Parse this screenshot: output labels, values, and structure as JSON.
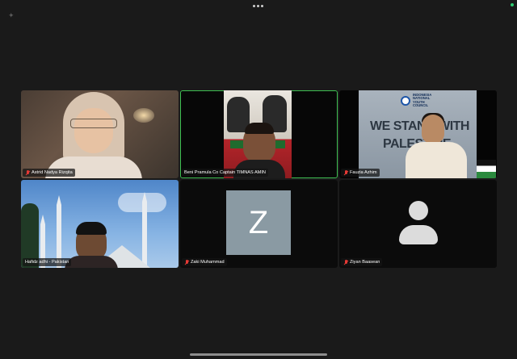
{
  "participants": [
    {
      "name": "Astrid Nadya Rizqita",
      "muted": true,
      "video": true
    },
    {
      "name": "Beni Pramula Co Captain TIMNAS AMIN",
      "muted": false,
      "video": true,
      "active_speaker": true
    },
    {
      "name": "Fauzia Azhim",
      "muted": true,
      "video": true,
      "background_logo_text": "INDONESIA NATIONAL YOUTH COUNCIL",
      "background_text_line1": "WE STAND WITH",
      "background_text_line2": "PALESTINE"
    },
    {
      "name": "Hafidz adhi - Pakistan",
      "muted": false,
      "video": true
    },
    {
      "name": "Zaki Muhammad",
      "muted": true,
      "video": false,
      "avatar_letter": "Z"
    },
    {
      "name": "Ziyan Baasean",
      "muted": true,
      "video": false
    }
  ],
  "colors": {
    "background": "#1a1a1a",
    "active_speaker_border": "#3fbf52",
    "muted_icon": "#e53935",
    "avatar_tile": "#8a9aa3"
  },
  "icons": {
    "top_menu": "more-dots-icon",
    "corner": "sparkle-icon",
    "muted": "mic-off-icon",
    "no_video": "user-silhouette-icon"
  }
}
